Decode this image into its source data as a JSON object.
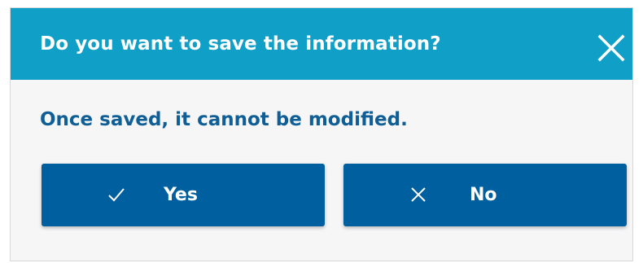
{
  "dialog": {
    "title": "Do you want to save the information?",
    "message": "Once saved, it cannot be modified.",
    "close_icon": "close-icon",
    "buttons": {
      "yes": {
        "label": "Yes",
        "icon": "check-icon"
      },
      "no": {
        "label": "No",
        "icon": "x-icon"
      }
    }
  },
  "colors": {
    "header": "#109fc6",
    "button": "#005f9e",
    "message_text": "#0f5e96",
    "body_background": "#f6f6f7"
  }
}
